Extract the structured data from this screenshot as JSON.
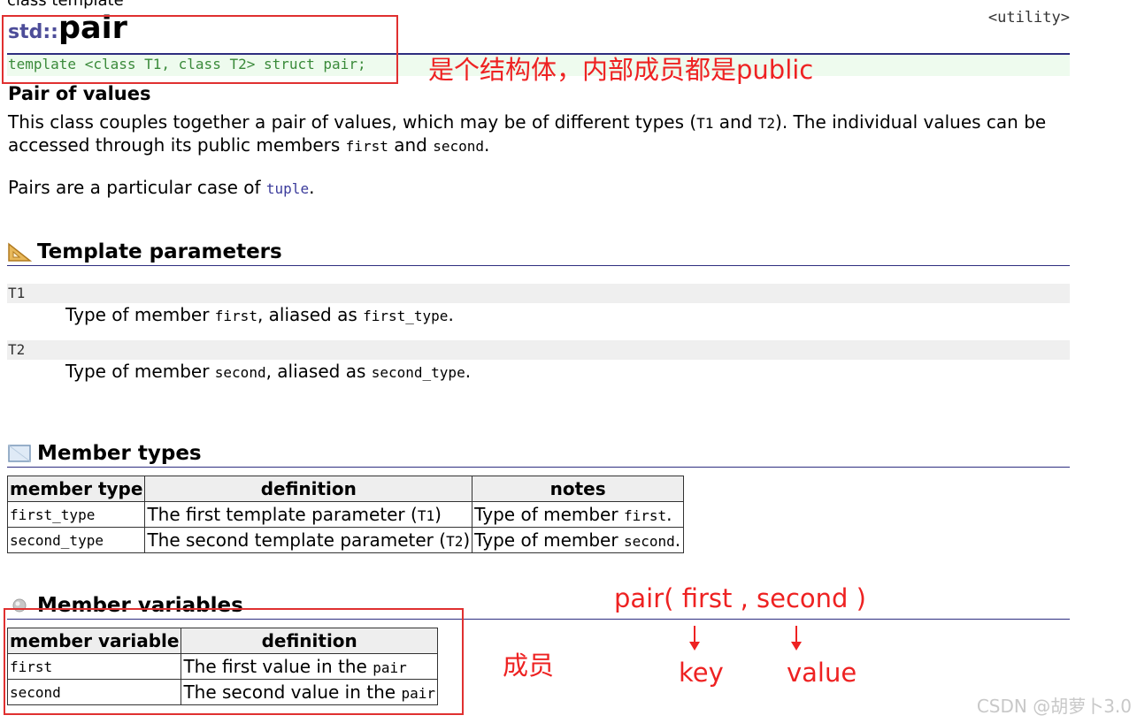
{
  "header": {
    "class_kind": "class template",
    "namespace": "std::",
    "name": "pair",
    "header_tag": "<utility>",
    "declaration": "template <class T1, class T2> struct pair;"
  },
  "description": {
    "subtitle": "Pair of values",
    "p1_a": "This class couples together a pair of values, which may be of different types (",
    "p1_t1": "T1",
    "p1_b": " and ",
    "p1_t2": "T2",
    "p1_c": "). The individual values can be accessed through its public members ",
    "p1_first": "first",
    "p1_d": " and ",
    "p1_second": "second",
    "p1_e": ".",
    "p2_a": "Pairs are a particular case of ",
    "p2_link": "tuple",
    "p2_b": "."
  },
  "template_params": {
    "title": "Template parameters",
    "params": [
      {
        "name": "T1",
        "desc_a": "Type of member ",
        "member": "first",
        "desc_b": ", aliased as ",
        "alias": "first_type",
        "desc_c": "."
      },
      {
        "name": "T2",
        "desc_a": "Type of member ",
        "member": "second",
        "desc_b": ", aliased as ",
        "alias": "second_type",
        "desc_c": "."
      }
    ]
  },
  "member_types": {
    "title": "Member types",
    "headers": [
      "member type",
      "definition",
      "notes"
    ],
    "rows": [
      {
        "type": "first_type",
        "def_a": "The first template parameter (",
        "def_code": "T1",
        "def_b": ")",
        "note_a": "Type of member ",
        "note_code": "first",
        "note_b": "."
      },
      {
        "type": "second_type",
        "def_a": "The second template parameter (",
        "def_code": "T2",
        "def_b": ")",
        "note_a": "Type of member ",
        "note_code": "second",
        "note_b": "."
      }
    ]
  },
  "member_variables": {
    "title": "Member variables",
    "headers": [
      "member variable",
      "definition"
    ],
    "rows": [
      {
        "name": "first",
        "def_a": "The first value in the ",
        "def_code": "pair"
      },
      {
        "name": "second",
        "def_a": "The second value in the ",
        "def_code": "pair"
      }
    ]
  },
  "annotations": {
    "struct_note": "是个结构体，内部成员都是public",
    "members_note": "成员",
    "pair_expr": "pair( first , second )",
    "key_label": "key",
    "value_label": "value"
  },
  "watermark": "CSDN @胡萝卜3.0",
  "colors": {
    "annotation_red": "#ee2222",
    "rule_navy": "#2e2e80",
    "namespace_blue": "#4d4d99",
    "declaration_green": "#3a8a3a"
  },
  "icons": {
    "template_params": "triangle-ruler-icon",
    "member_types": "box-icon",
    "member_variables": "bullet-dot-icon"
  }
}
